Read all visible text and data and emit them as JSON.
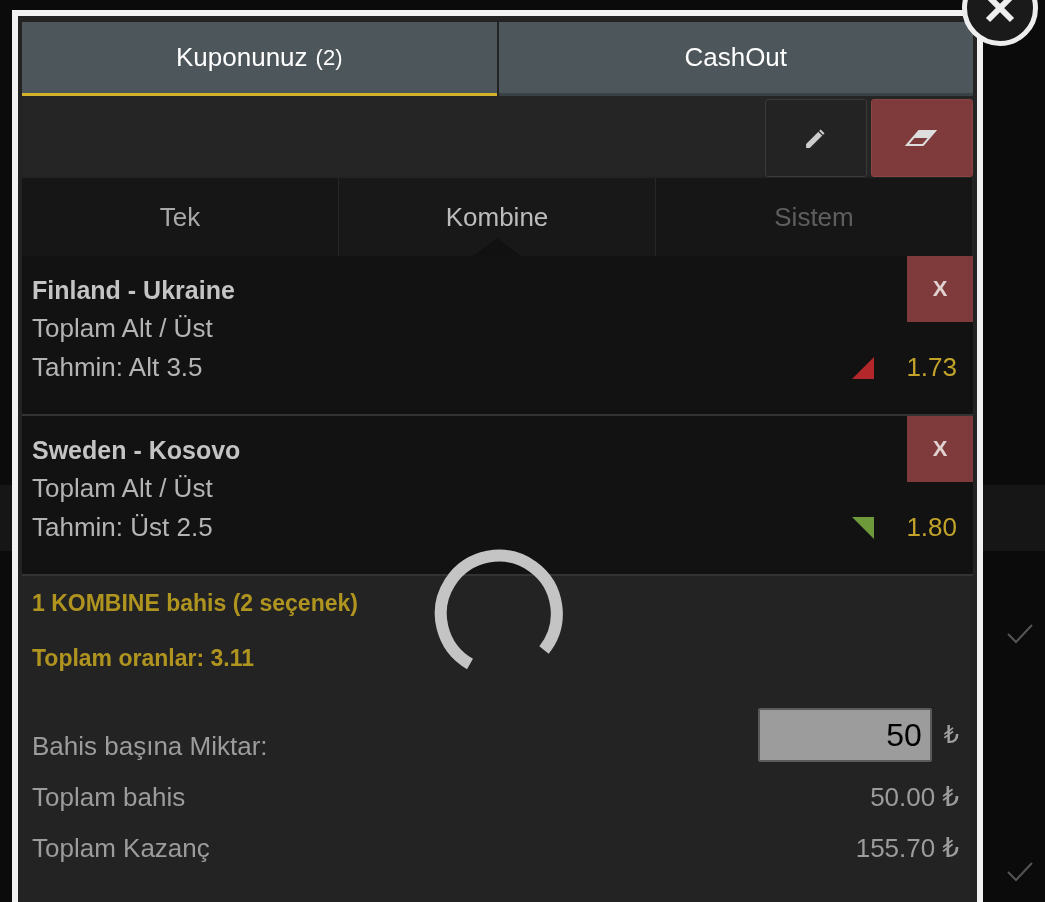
{
  "tabs": [
    {
      "label": "Kuponunuz",
      "count": "(2)",
      "selected": true
    },
    {
      "label": "CashOut",
      "selected": false
    }
  ],
  "bet_types": [
    {
      "label": "Tek",
      "selected": false,
      "disabled": false
    },
    {
      "label": "Kombine",
      "selected": true,
      "disabled": false
    },
    {
      "label": "Sistem",
      "selected": false,
      "disabled": true
    }
  ],
  "bets": [
    {
      "match": "Finland - Ukraine",
      "market": "Toplam Alt / Üst",
      "prediction": "Tahmin: Alt 3.5",
      "odds": "1.73",
      "odds_change": {
        "kind": "down",
        "color": "#b3262a"
      },
      "remove": "X"
    },
    {
      "match": "Sweden - Kosovo",
      "market": "Toplam Alt / Üst",
      "prediction": "Tahmin: Üst 2.5",
      "odds": "1.80",
      "odds_change": {
        "kind": "up",
        "color": "#6f9a3c"
      },
      "remove": "X"
    }
  ],
  "summary": {
    "title": "1 KOMBINE bahis (2 seçenek)",
    "total_odds": "Toplam oranlar: 3.11",
    "stake_label": "Bahis başına Miktar:",
    "stake_value": "50",
    "stake_currency": "₺",
    "rows": [
      {
        "label": "Toplam bahis",
        "value": "50.00 ₺"
      },
      {
        "label": "Toplam Kazanç",
        "value": "155.70 ₺"
      }
    ]
  },
  "loading": true
}
